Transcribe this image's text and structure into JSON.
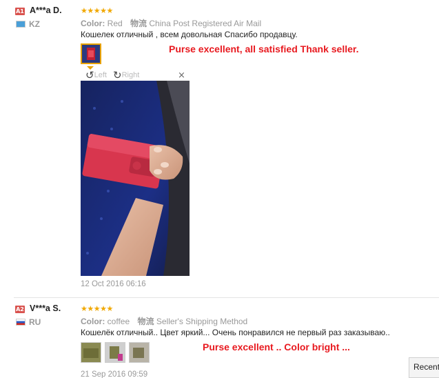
{
  "reviews": [
    {
      "badge": "A1",
      "buyer": "A***a D.",
      "country": "KZ",
      "rating": 5,
      "stars": "★★★★★",
      "color_label": "Color:",
      "color_value": "Red",
      "logistics_label": "物流",
      "logistics_value": "China Post Registered Air Mail",
      "comment": "Кошелек отличный , всем довольная Спасибо продавцу.",
      "translation": "Purse excellent, all satisfied Thank seller.",
      "viewer": {
        "left": "Left",
        "right": "Right",
        "close": "×"
      },
      "date": "12 Oct 2016 06:16"
    },
    {
      "badge": "A2",
      "buyer": "V***a S.",
      "country": "RU",
      "rating": 5,
      "stars": "★★★★★",
      "color_label": "Color:",
      "color_value": "coffee",
      "logistics_label": "物流",
      "logistics_value": "Seller's Shipping Method",
      "comment": "Кошелёк отличный.. Цвет яркий... Очень понравился не первый раз заказываю..",
      "translation": "Purse excellent .. Color bright ...",
      "date": "21 Sep 2016 09:59"
    }
  ],
  "recent_tab": "Recent",
  "colors": {
    "accent_red": "#e8191f",
    "star": "#f1a800",
    "badge": "#d9534f"
  }
}
